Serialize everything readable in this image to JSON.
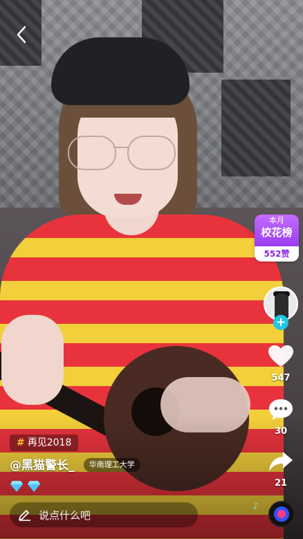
{
  "nav": {
    "back_icon": "chevron-left-icon"
  },
  "badge": {
    "line1": "本月",
    "line2": "校花榜",
    "likes": "552赞"
  },
  "actions": {
    "like_count": "547",
    "comment_count": "30",
    "share_count": "21"
  },
  "post": {
    "topic": "再见2018",
    "username": "@黑猫警长_",
    "school": "华南理工大学",
    "diamond_icon": "diamond-icon"
  },
  "comment": {
    "placeholder": "说点什么吧"
  },
  "colors": {
    "accent_purple": "#9a3df0",
    "follow_blue": "#1fc7e6",
    "topic_hash": "#f7c530"
  }
}
